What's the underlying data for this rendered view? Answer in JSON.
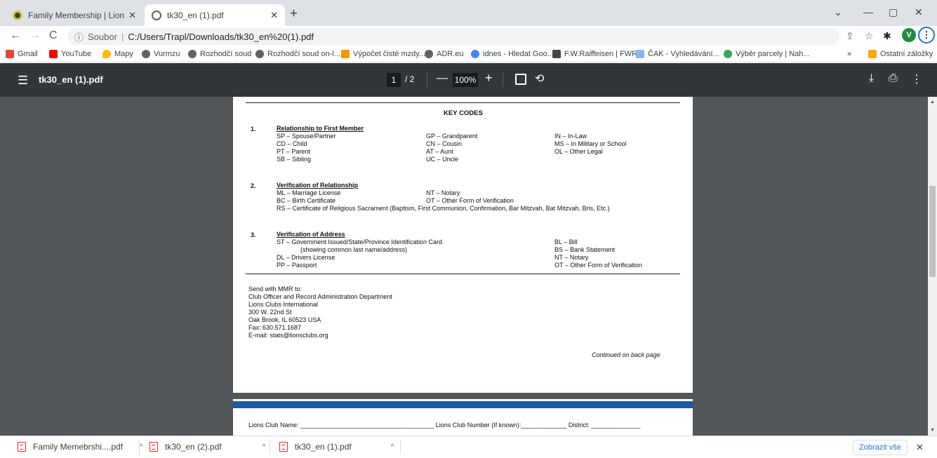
{
  "browser": {
    "tabs": [
      {
        "title": "Family Membership | Lions Clubs",
        "active": false
      },
      {
        "title": "tk30_en (1).pdf",
        "active": true
      }
    ],
    "new_tab": "+",
    "window_controls": {
      "collapse": "⌄",
      "minimize": "—",
      "restore": "▢",
      "close": "✕"
    },
    "address": {
      "info_icon": "ⓘ",
      "scheme": "Soubor",
      "separator": "|",
      "url": "C:/Users/Trapl/Downloads/tk30_en%20(1).pdf"
    },
    "nav": {
      "back": "←",
      "forward": "→",
      "reload": "C"
    },
    "avatar_letter": "V",
    "bookmarks": [
      {
        "label": "Gmail",
        "color": "#ea4335"
      },
      {
        "label": "YouTube",
        "color": "#ff0000"
      },
      {
        "label": "Mapy",
        "color": "#fbbc05"
      },
      {
        "label": "Vurmzu",
        "color": "#5f6368"
      },
      {
        "label": "Rozhodčí soud",
        "color": "#5f6368"
      },
      {
        "label": "Rozhodčí soud on-l...",
        "color": "#5f6368"
      },
      {
        "label": "Výpočet čisté mzdy...",
        "color": "#f29900"
      },
      {
        "label": "ADR.eu",
        "color": "#5f6368"
      },
      {
        "label": "idnes - Hledat Goo...",
        "color": "#4285f4"
      },
      {
        "label": "F.W.Raiffeisen | FWR",
        "color": "#444444"
      },
      {
        "label": "ČAK - Vyhledávání...",
        "color": "#8ab4f8"
      },
      {
        "label": "Výběr parcely | Nah...",
        "color": "#34a853"
      }
    ],
    "bookmarks_more": "»",
    "other_bookmarks": "Ostatní záložky"
  },
  "pdf_toolbar": {
    "title": "tk30_en (1).pdf",
    "current_page": "1",
    "total_pages": "/ 2",
    "zoom": "100%"
  },
  "document": {
    "heading": "KEY CODES",
    "sections": {
      "s1": {
        "num": "1.",
        "title": "Relationship to First Member",
        "col1": [
          "SP  –  Spouse/Partner",
          "CD  –  Child",
          "PT  –  Parent",
          "SB  –  Sibling"
        ],
        "col2": [
          "GP  –  Grandparent",
          "CN  –  Cousin",
          "AT  –  Aunt",
          "UC  –  Uncle"
        ],
        "col3": [
          "IN  –  In-Law",
          "MS  –  In Military or School",
          "OL  –  Other Legal"
        ]
      },
      "s2": {
        "num": "2.",
        "title": "Verification of Relationship",
        "ml": "ML  –  Marriage License",
        "bc": "BC  –  Birth Certificate",
        "nt": "NT  –  Notary",
        "ot": "OT  –  Other Form of Verification",
        "rs": "RS  –  Certificate of Religious Sacrament (Baptism, First Communion, Confirmation, Bar Mitzvah, Bat Mitzvah, Bris, Etc.)"
      },
      "s3": {
        "num": "3.",
        "title": "Verification of Address",
        "left": [
          "ST  –  Government Issued/State/Province Identification Card",
          "(showing common last name/address)",
          "DL  –  Drivers License",
          "PP  –  Passport"
        ],
        "right": [
          "BL  –  Bill",
          "BS  –  Bank Statement",
          "NT  –  Notary",
          "OT  –  Other Form of Verification"
        ]
      }
    },
    "send_with": [
      "Send with MMR to:",
      "Club Officer and Record Administration Department",
      "Lions Clubs International",
      "300 W. 22nd St",
      "Oak Brook, IL 60523 USA",
      "Fax: 630.571.1687",
      "E-mail: stats@lionsclubs.org"
    ],
    "continued": "Continued on back page",
    "page2_line": "Lions Club Name: ______________________________________ Lions Club Number (If known):_____________  District: ______________"
  },
  "downloads": {
    "items": [
      "Family Memebrshi....pdf",
      "tk30_en (2).pdf",
      "tk30_en (1).pdf"
    ],
    "show_all": "Zobrazit vše",
    "close": "✕"
  },
  "colors": {
    "pdf_toolbar": "#323639",
    "viewer_bg": "#525659",
    "page2_band": "#1b5aa8",
    "avatar": "#1e8e3e"
  }
}
